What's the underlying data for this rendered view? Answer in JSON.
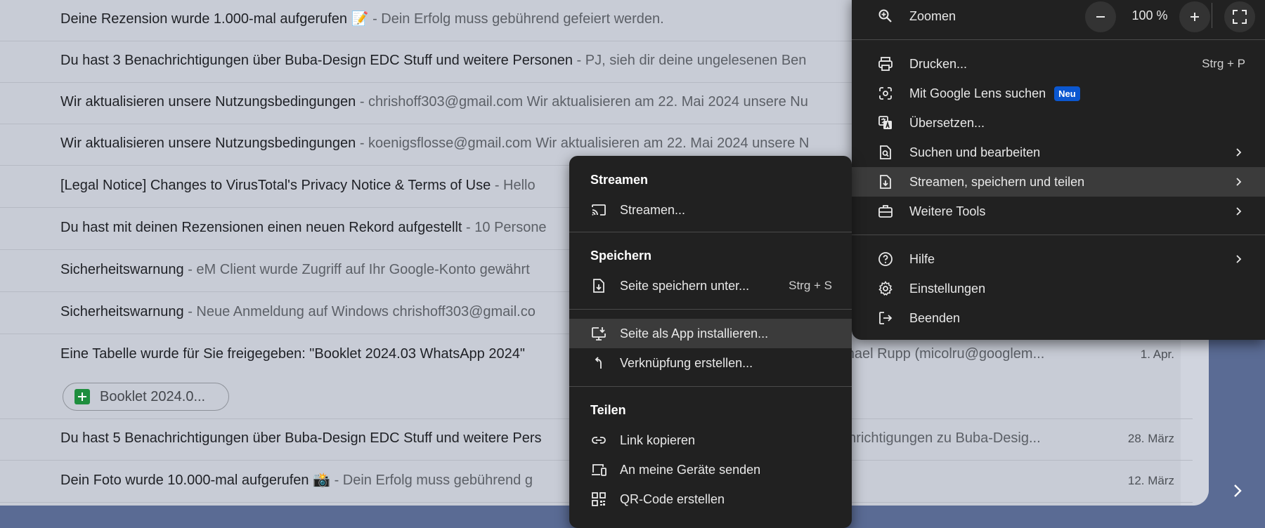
{
  "emails": [
    {
      "subject": "Deine Rezension wurde 1.000-mal aufgerufen 📝",
      "snippet": "- Dein Erfolg muss gebührend gefeiert werden.",
      "date": ""
    },
    {
      "subject": "Du hast 3 Benachrichtigungen über Buba-Design EDC Stuff und weitere Personen",
      "snippet": "- PJ, sieh dir deine ungelesenen Ben",
      "date": ""
    },
    {
      "subject": "Wir aktualisieren unsere Nutzungsbedingungen",
      "snippet": "- chrishoff303@gmail.com Wir aktualisieren am 22. Mai 2024 unsere Nu",
      "date": ""
    },
    {
      "subject": "Wir aktualisieren unsere Nutzungsbedingungen",
      "snippet": "- koenigsflosse@gmail.com Wir aktualisieren am 22. Mai 2024 unsere N",
      "date": ""
    },
    {
      "subject": "[Legal Notice] Changes to VirusTotal's Privacy Notice & Terms of Use",
      "snippet": "- Hello",
      "date": ""
    },
    {
      "subject": "Du hast mit deinen Rezensionen einen neuen Rekord aufgestellt",
      "snippet": "- 10 Persone",
      "date": ""
    },
    {
      "subject": "Sicherheitswarnung",
      "snippet": "- eM Client wurde Zugriff auf Ihr Google-Konto gewährt",
      "date": ""
    },
    {
      "subject": "Sicherheitswarnung",
      "snippet": "- Neue Anmeldung auf Windows chrishoff303@gmail.co",
      "date": ""
    },
    {
      "subject": "Eine Tabelle wurde für Sie freigegeben: \"Booklet 2024.03 WhatsApp 2024\"",
      "snippet": "- chael Rupp (micolru@googlem...",
      "date": "1. Apr.",
      "chip": "Booklet 2024.0..."
    },
    {
      "subject": "Du hast 5 Benachrichtigungen über Buba-Design EDC Stuff und weitere Pers",
      "snippet": "achrichtigungen zu Buba-Desig...",
      "date": "28. März"
    },
    {
      "subject": "Dein Foto wurde 10.000-mal aufgerufen 📸",
      "snippet": "- Dein Erfolg muss gebührend g",
      "date": "12. März"
    }
  ],
  "main_menu": {
    "zoom": {
      "label": "Zoomen",
      "value": "100 %",
      "minus": "−",
      "plus": "+"
    },
    "items": [
      {
        "label": "Drucken...",
        "shortcut": "Strg + P",
        "icon": "printer-icon"
      },
      {
        "label": "Mit Google Lens suchen",
        "badge": "Neu",
        "icon": "google-lens-icon"
      },
      {
        "label": "Übersetzen...",
        "icon": "translate-icon"
      },
      {
        "label": "Suchen und bearbeiten",
        "icon": "find-page-icon"
      },
      {
        "label": "Streamen, speichern und teilen",
        "icon": "save-file-icon"
      },
      {
        "label": "Weitere Tools",
        "icon": "toolbox-icon"
      },
      {
        "label": "Hilfe",
        "icon": "help-icon"
      },
      {
        "label": "Einstellungen",
        "icon": "gear-icon"
      },
      {
        "label": "Beenden",
        "icon": "exit-icon"
      }
    ]
  },
  "sub_menu": {
    "stream_title": "Streamen",
    "stream_item": "Streamen...",
    "save_title": "Speichern",
    "save_page": "Seite speichern unter...",
    "save_shortcut": "Strg + S",
    "install_app": "Seite als App installieren...",
    "shortcut": "Verknüpfung erstellen...",
    "share_title": "Teilen",
    "copy_link": "Link kopieren",
    "send_devices": "An meine Geräte senden",
    "qr_code": "QR-Code erstellen"
  }
}
